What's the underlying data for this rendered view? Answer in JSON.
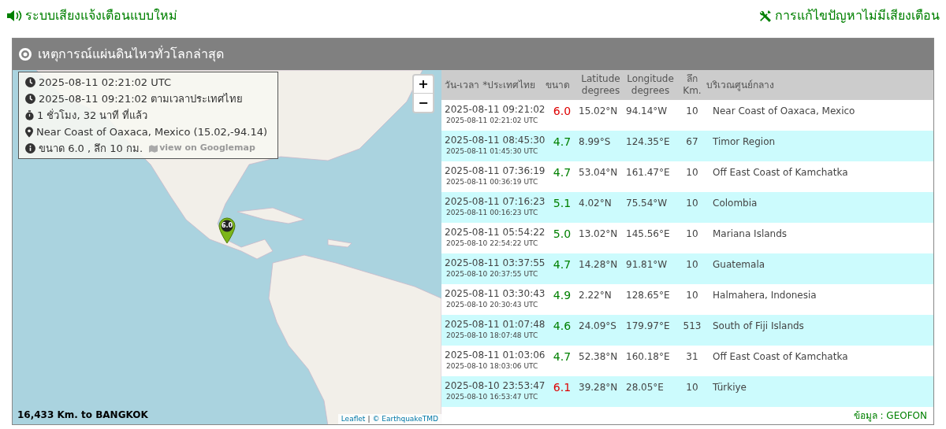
{
  "top_links": [
    {
      "kind": "sound",
      "label": "ระบบเสียงแจ้งเตือนแบบใหม่"
    },
    {
      "kind": "tools",
      "label": "การแก้ไขปัญหาไม่มีเสียงเตือน"
    }
  ],
  "panel": {
    "title": "เหตุการณ์แผ่นดินไหวทั่วโลกล่าสุด"
  },
  "map": {
    "info": [
      {
        "kind": "clock",
        "text": "2025-08-11 02:21:02 UTC"
      },
      {
        "kind": "clock",
        "text": "2025-08-11 09:21:02 ตามเวลาประเทศไทย"
      },
      {
        "kind": "stopwatch",
        "text": "1 ชั่วโมง, 32 นาที ที่แล้ว"
      },
      {
        "kind": "pin",
        "text": "Near Coast of Oaxaca, Mexico (15.02,-94.14)"
      },
      {
        "kind": "info",
        "text": "ขนาด 6.0 , ลึก 10 กม.",
        "link": "view on Googlemap"
      }
    ],
    "zoom_in": "+",
    "zoom_out": "−",
    "marker": "6.0",
    "distance": "16,433 Km. to BANGKOK",
    "attribution": [
      "Leaflet",
      "|",
      "© EarthquakeTMD"
    ]
  },
  "table": {
    "columns": [
      "วัน-เวลา *ประเทศไทย",
      "ขนาด",
      "Latitude degrees",
      "Longitude degrees",
      "ลึก Km.",
      "บริเวณศูนย์กลาง"
    ],
    "rows": [
      {
        "local": "2025-08-11 09:21:02",
        "utc": "2025-08-11 02:21:02 UTC",
        "mag": "6.0",
        "color": "#dd0000",
        "lat": "15.02°N",
        "lon": "94.14°W",
        "depth": "10",
        "region": "Near Coast of Oaxaca, Mexico"
      },
      {
        "local": "2025-08-11 08:45:30",
        "utc": "2025-08-11 01:45:30 UTC",
        "mag": "4.7",
        "color": "#008000",
        "lat": "8.99°S",
        "lon": "124.35°E",
        "depth": "67",
        "region": "Timor Region"
      },
      {
        "local": "2025-08-11 07:36:19",
        "utc": "2025-08-11 00:36:19 UTC",
        "mag": "4.7",
        "color": "#008000",
        "lat": "53.04°N",
        "lon": "161.47°E",
        "depth": "10",
        "region": "Off East Coast of Kamchatka"
      },
      {
        "local": "2025-08-11 07:16:23",
        "utc": "2025-08-11 00:16:23 UTC",
        "mag": "5.1",
        "color": "#008000",
        "lat": "4.02°N",
        "lon": "75.54°W",
        "depth": "10",
        "region": "Colombia"
      },
      {
        "local": "2025-08-11 05:54:22",
        "utc": "2025-08-10 22:54:22 UTC",
        "mag": "5.0",
        "color": "#008000",
        "lat": "13.02°N",
        "lon": "145.56°E",
        "depth": "10",
        "region": "Mariana Islands"
      },
      {
        "local": "2025-08-11 03:37:55",
        "utc": "2025-08-10 20:37:55 UTC",
        "mag": "4.7",
        "color": "#008000",
        "lat": "14.28°N",
        "lon": "91.81°W",
        "depth": "10",
        "region": "Guatemala"
      },
      {
        "local": "2025-08-11 03:30:43",
        "utc": "2025-08-10 20:30:43 UTC",
        "mag": "4.9",
        "color": "#008000",
        "lat": "2.22°N",
        "lon": "128.65°E",
        "depth": "10",
        "region": "Halmahera, Indonesia"
      },
      {
        "local": "2025-08-11 01:07:48",
        "utc": "2025-08-10 18:07:48 UTC",
        "mag": "4.6",
        "color": "#008000",
        "lat": "24.09°S",
        "lon": "179.97°E",
        "depth": "513",
        "region": "South of Fiji Islands"
      },
      {
        "local": "2025-08-11 01:03:06",
        "utc": "2025-08-10 18:03:06 UTC",
        "mag": "4.7",
        "color": "#008000",
        "lat": "52.38°N",
        "lon": "160.18°E",
        "depth": "31",
        "region": "Off East Coast of Kamchatka"
      },
      {
        "local": "2025-08-10 23:53:47",
        "utc": "2025-08-10 16:53:47 UTC",
        "mag": "6.1",
        "color": "#dd0000",
        "lat": "39.28°N",
        "lon": "28.05°E",
        "depth": "10",
        "region": "Türkiye"
      }
    ],
    "source": "ข้อมูล : GEOFON"
  }
}
